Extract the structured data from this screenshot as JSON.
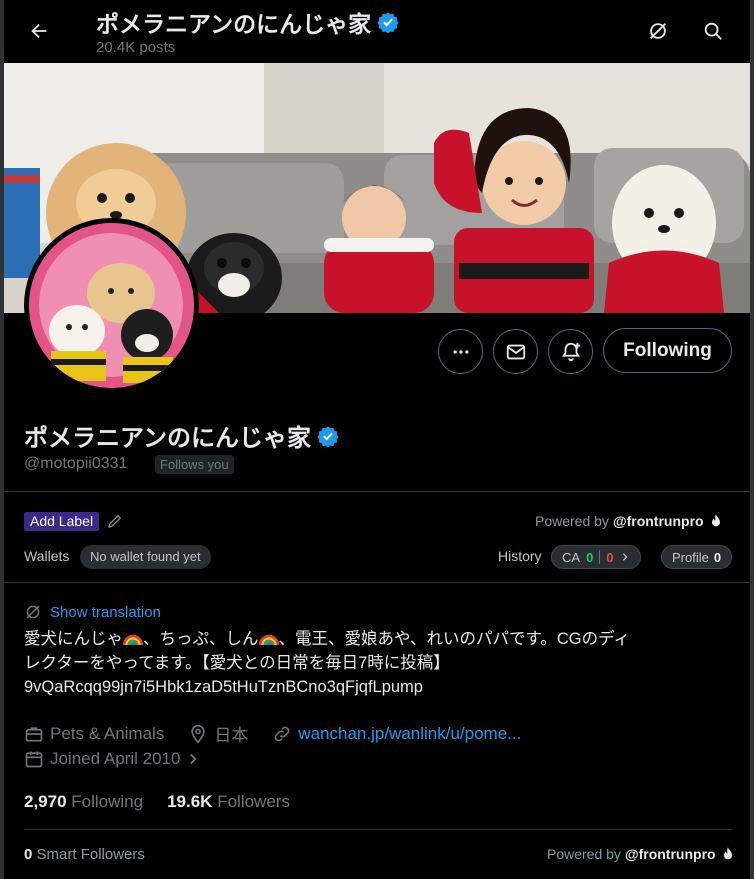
{
  "header": {
    "title": "ポメラニアンのにんじゃ家",
    "posts_count": "20.4K posts"
  },
  "profile": {
    "display_name": "ポメラニアンのにんじゃ家",
    "handle": "@motopii0331",
    "follows_you": "Follows you",
    "following_button": "Following"
  },
  "extension": {
    "add_label": "Add Label",
    "powered_by": "Powered by",
    "powered_brand": "@frontrunpro",
    "wallets_label": "Wallets",
    "wallet_status": "No wallet found yet",
    "history_label": "History",
    "ca_label": "CA",
    "ca_green": "0",
    "ca_red": "0",
    "profile_label": "Profile",
    "profile_count": "0"
  },
  "bio": {
    "show_translation": "Show translation",
    "line1_a": "愛犬にんじゃ",
    "line1_b": "、ちっぷ、しん",
    "line1_c": "、電王、愛娘あや、れいのパパです。CGのディ",
    "line2": "レクターをやってます。【愛犬との日常を毎日7時に投稿】",
    "line3": "9vQaRcqq99jn7i5Hbk1zaD5tHuTznBCno3qFjqfLpump"
  },
  "meta": {
    "category": "Pets & Animals",
    "location": "日本",
    "link": "wanchan.jp/wanlink/u/pome...",
    "joined": "Joined April 2010"
  },
  "stats": {
    "following_count": "2,970",
    "following_label": "Following",
    "followers_count": "19.6K",
    "followers_label": "Followers",
    "smart_count": "0",
    "smart_label": "Smart Followers"
  },
  "colors": {
    "accent": "#1d9bf0",
    "verified": "#1d9bf0",
    "label_bg": "#3b2a8a"
  }
}
